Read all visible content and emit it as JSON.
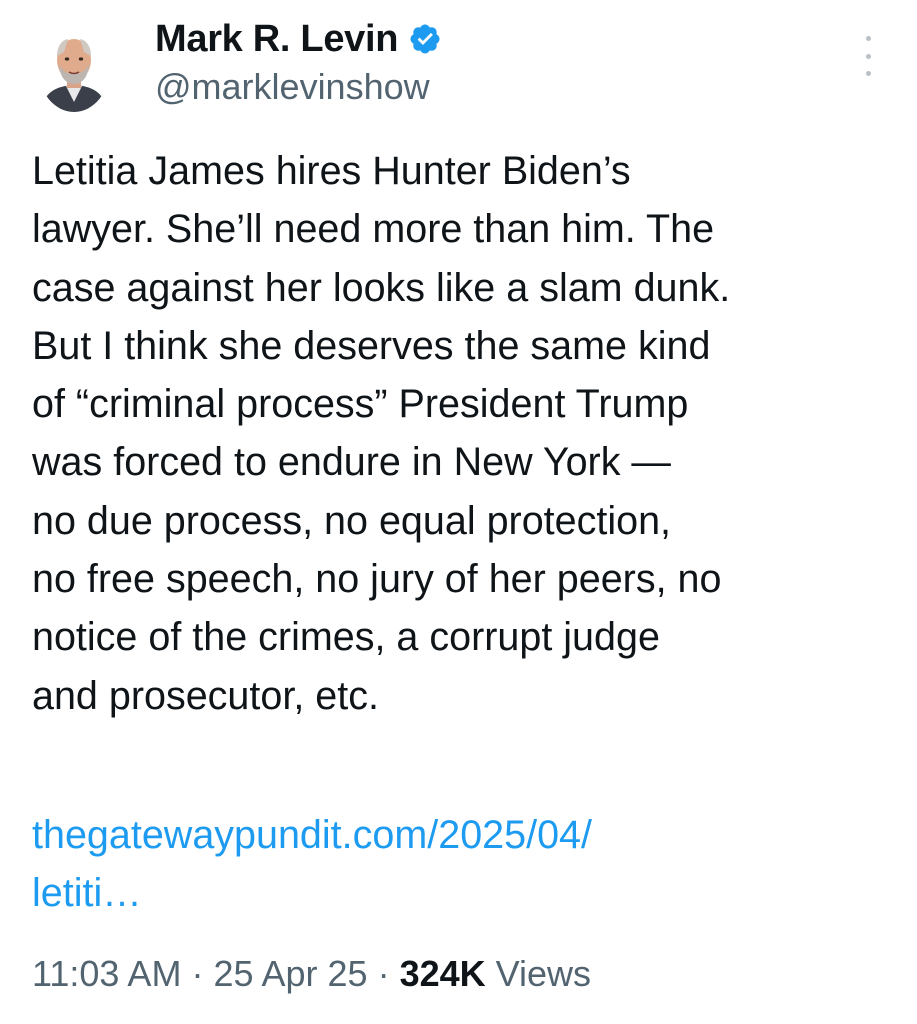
{
  "author": {
    "display_name": "Mark R. Levin",
    "handle": "@marklevinshow",
    "verified_icon": "verified-badge-icon",
    "avatar_icon": "avatar-photo"
  },
  "post": {
    "lines": [
      "Letitia James hires Hunter Biden’s",
      "lawyer. She’ll need more than him.  The",
      "case against her looks like a slam dunk.",
      "But I think she deserves the same kind",
      "of “criminal process” President Trump",
      "was forced to endure in New York —",
      "no due process, no equal protection,",
      "no free speech, no jury of her peers, no",
      "notice of the crimes, a corrupt judge",
      "and prosecutor, etc."
    ],
    "link_lines": [
      "thegatewaypundit.com/2025/04/",
      "letiti…"
    ]
  },
  "meta": {
    "time": "11:03 AM",
    "sep1": " · ",
    "date": "25 Apr 25",
    "sep2": " · ",
    "views_count": "324K",
    "views_label": " Views"
  },
  "colors": {
    "text": "#0f1419",
    "secondary": "#536471",
    "link": "#1d9bf0",
    "verified": "#1d9bf0"
  },
  "icons": {
    "more": "more-options-icon"
  }
}
